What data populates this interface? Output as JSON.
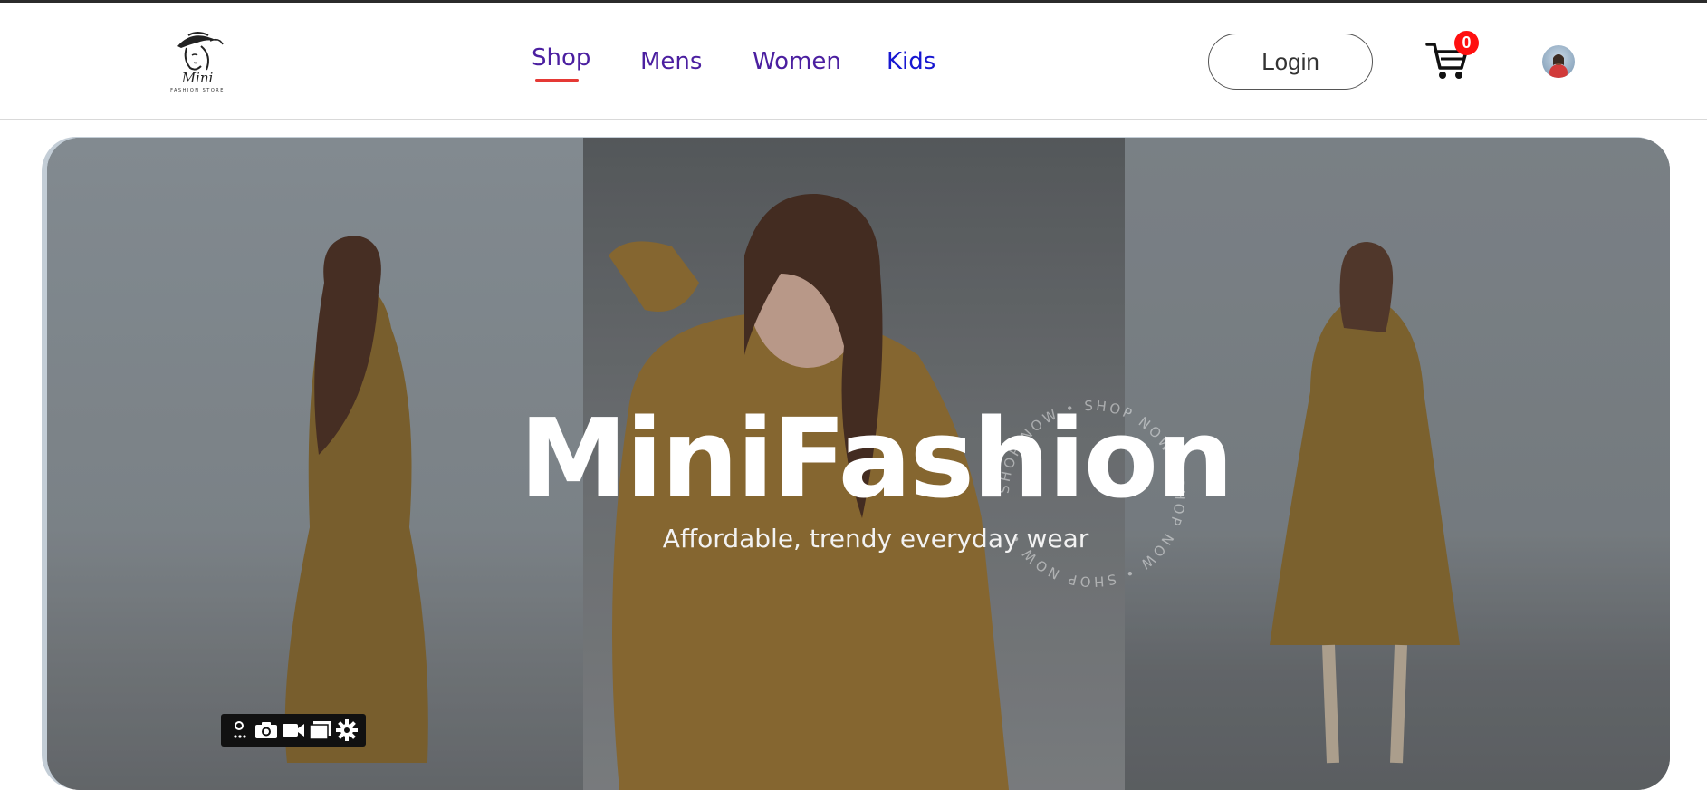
{
  "brand": {
    "logo_script": "Mini",
    "logo_sub": "FASHION STORE"
  },
  "nav": {
    "items": [
      {
        "label": "Shop",
        "active": true
      },
      {
        "label": "Mens",
        "active": false
      },
      {
        "label": "Women",
        "active": false
      },
      {
        "label": "Kids",
        "active": false
      }
    ]
  },
  "header": {
    "login_label": "Login",
    "cart_count": "0"
  },
  "hero": {
    "title": "MiniFashion",
    "subtitle": "Affordable, trendy everyday wear",
    "ring_text": "SHOP NOW • SHOP NOW • SHOP NOW • SHOP NOW •"
  },
  "icons": {
    "cart": "cart-icon",
    "avatar": "avatar",
    "toolbar": [
      "link-icon",
      "camera-icon",
      "video-icon",
      "screens-icon",
      "gear-icon"
    ]
  },
  "colors": {
    "nav_text": "#4b1fa0",
    "nav_kids": "#1717d1",
    "active_underline": "#e53935",
    "badge": "#ff1010"
  }
}
